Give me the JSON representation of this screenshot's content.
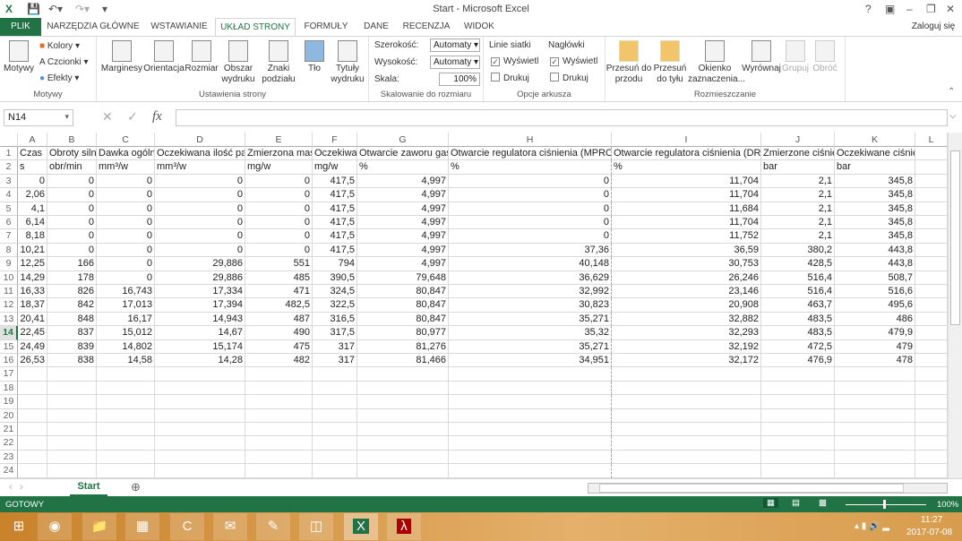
{
  "window": {
    "title": "Start - Microsoft Excel",
    "help": "?",
    "signin": "Zaloguj się"
  },
  "tabs": [
    "PLIK",
    "NARZĘDZIA GŁÓWNE",
    "WSTAWIANIE",
    "UKŁAD STRONY",
    "FORMUŁY",
    "DANE",
    "RECENZJA",
    "WIDOK"
  ],
  "ribbon": {
    "motywy": {
      "label": "Motywy",
      "button": "Motywy",
      "kolory": "Kolory",
      "czcionki": "Czcionki",
      "efekty": "Efekty"
    },
    "ustawienia": {
      "label": "Ustawienia strony",
      "buttons": [
        "Marginesy",
        "Orientacja",
        "Rozmiar",
        "Obszar wydruku",
        "Znaki podziału",
        "Tło",
        "Tytuły wydruku"
      ]
    },
    "skalowanie": {
      "label": "Skalowanie do rozmiaru",
      "szerokosc": "Szerokość:",
      "szerokosc_value": "Automaty",
      "wysokosc": "Wysokość:",
      "wysokosc_value": "Automaty",
      "skala": "Skala:",
      "skala_value": "100%"
    },
    "opcje": {
      "label": "Opcje arkusza",
      "linie": "Linie siatki",
      "naglowki": "Nagłówki",
      "wyswietl": "Wyświetl",
      "drukuj": "Drukuj"
    },
    "rozmieszczanie": {
      "label": "Rozmieszczanie",
      "buttons": [
        "Przesuń do przodu",
        "Przesuń do tyłu",
        "Okienko zaznaczenia...",
        "Wyrównaj",
        "Grupuj",
        "Obróć"
      ]
    }
  },
  "formula_bar": {
    "name_box": "N14",
    "fx": "fx",
    "value": ""
  },
  "columns": [
    "A",
    "B",
    "C",
    "D",
    "E",
    "F",
    "G",
    "H",
    "I",
    "J",
    "K",
    "L"
  ],
  "rows": [
    [
      "Czas",
      "Obroty silnika",
      "Dawka ogólna",
      "Oczekiwana ilość paliwa",
      "Zmierzona masa",
      "Oczekiwana",
      "Otwarcie zaworu gas",
      "Otwarcie regulatora ciśnienia (MPRO",
      "Otwarcie regulatora ciśnienia (DRV",
      "Zmierzone ciśnienie",
      "Oczekiwane ciśnienie pal",
      ""
    ],
    [
      "s",
      "obr/min",
      "mm³/w",
      "mm³/w",
      "mg/w",
      "mg/w",
      "%",
      "%",
      "%",
      "bar",
      "bar",
      ""
    ],
    [
      "0",
      "0",
      "0",
      "0",
      "0",
      "417,5",
      "4,997",
      "0",
      "11,704",
      "2,1",
      "345,8",
      ""
    ],
    [
      "2,06",
      "0",
      "0",
      "0",
      "0",
      "417,5",
      "4,997",
      "0",
      "11,704",
      "2,1",
      "345,8",
      ""
    ],
    [
      "4,1",
      "0",
      "0",
      "0",
      "0",
      "417,5",
      "4,997",
      "0",
      "11,684",
      "2,1",
      "345,8",
      ""
    ],
    [
      "6,14",
      "0",
      "0",
      "0",
      "0",
      "417,5",
      "4,997",
      "0",
      "11,704",
      "2,1",
      "345,8",
      ""
    ],
    [
      "8,18",
      "0",
      "0",
      "0",
      "0",
      "417,5",
      "4,997",
      "0",
      "11,752",
      "2,1",
      "345,8",
      ""
    ],
    [
      "10,21",
      "0",
      "0",
      "0",
      "0",
      "417,5",
      "4,997",
      "37,36",
      "36,59",
      "380,2",
      "443,8",
      ""
    ],
    [
      "12,25",
      "166",
      "0",
      "29,886",
      "551",
      "794",
      "4,997",
      "40,148",
      "30,753",
      "428,5",
      "443,8",
      ""
    ],
    [
      "14,29",
      "178",
      "0",
      "29,886",
      "485",
      "390,5",
      "79,648",
      "36,629",
      "26,246",
      "516,4",
      "508,7",
      ""
    ],
    [
      "16,33",
      "826",
      "16,743",
      "17,334",
      "471",
      "324,5",
      "80,847",
      "32,992",
      "23,146",
      "516,4",
      "516,6",
      ""
    ],
    [
      "18,37",
      "842",
      "17,013",
      "17,394",
      "482,5",
      "322,5",
      "80,847",
      "30,823",
      "20,908",
      "463,7",
      "495,6",
      ""
    ],
    [
      "20,41",
      "848",
      "16,17",
      "14,943",
      "487",
      "316,5",
      "80,847",
      "35,271",
      "32,882",
      "483,5",
      "486",
      ""
    ],
    [
      "22,45",
      "837",
      "15,012",
      "14,67",
      "490",
      "317,5",
      "80,977",
      "35,32",
      "32,293",
      "483,5",
      "479,9",
      ""
    ],
    [
      "24,49",
      "839",
      "14,802",
      "15,174",
      "475",
      "317",
      "81,276",
      "35,271",
      "32,192",
      "472,5",
      "479",
      ""
    ],
    [
      "26,53",
      "838",
      "14,58",
      "14,28",
      "482",
      "317",
      "81,466",
      "34,951",
      "32,172",
      "476,9",
      "478",
      ""
    ]
  ],
  "total_rows": 24,
  "selected_row": 14,
  "sheet_tabs": [
    "Start"
  ],
  "status": {
    "mode": "GOTOWY",
    "zoom": "100%"
  },
  "taskbar": {
    "time": "11:27",
    "date": "2017-07-08",
    "apps": [
      "chrome",
      "file-explorer",
      "calculator",
      "ccleaner",
      "thunderbird",
      "notepad",
      "network",
      "excel",
      "acrobat"
    ]
  },
  "colors": {
    "accent": "#217346"
  }
}
